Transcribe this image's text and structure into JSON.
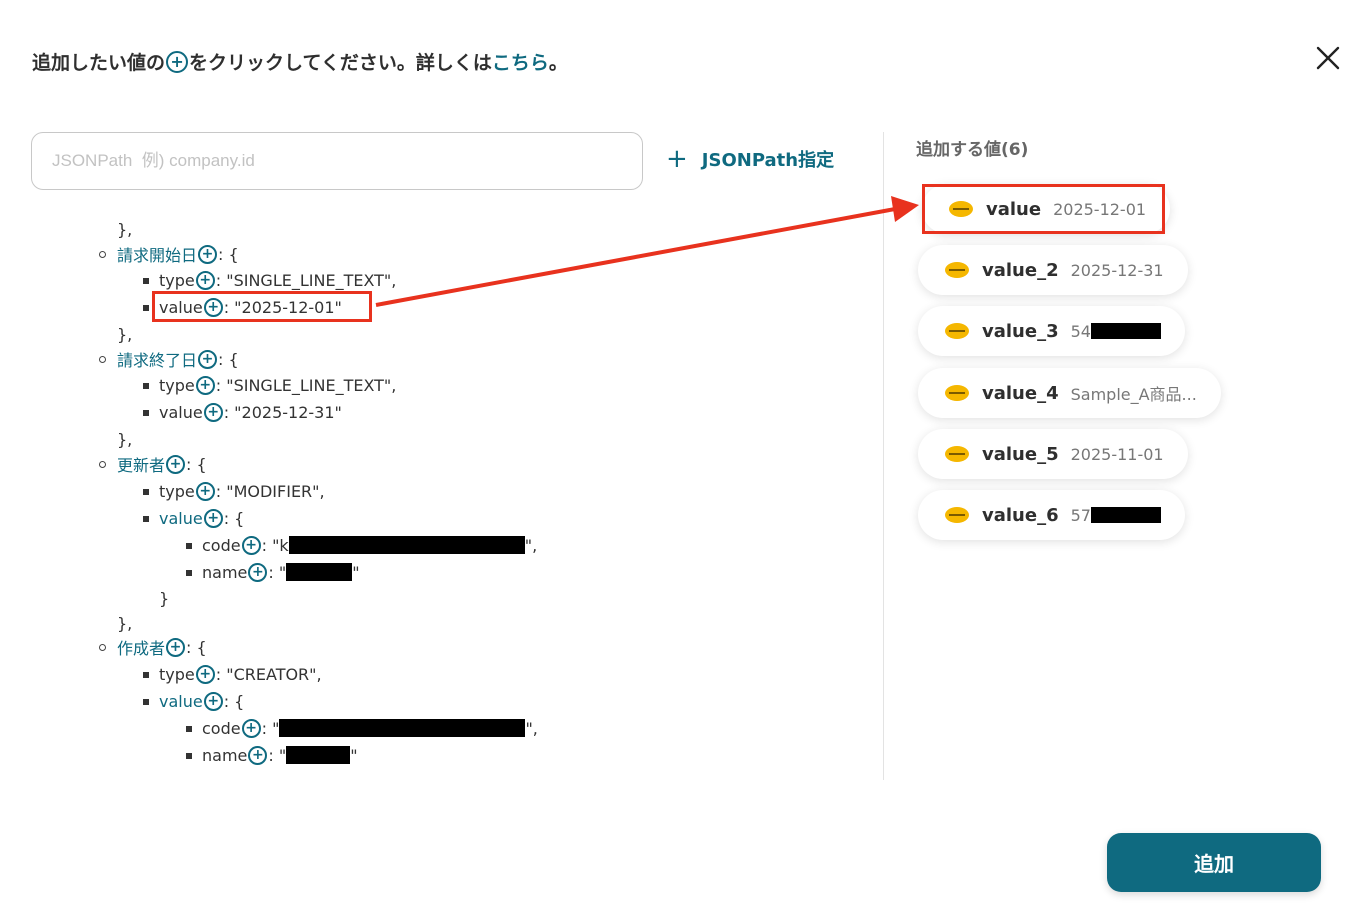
{
  "header": {
    "text_before": "追加したい値の",
    "text_after": "をクリックしてください。詳しくは",
    "link": "こちら",
    "period": "。"
  },
  "search": {
    "placeholder": "JSONPath  例) company.id"
  },
  "jsonpath_button": {
    "label": "JSONPath指定"
  },
  "tree": {
    "l1": "},",
    "l2_key": "請求開始日",
    "l2_rest": ": {",
    "l3_key": "type",
    "l3_rest": ": \"SINGLE_LINE_TEXT\",",
    "l4_key": "value",
    "l4_rest": ": \"2025-12-01\"",
    "l5": "},",
    "l6_key": "請求終了日",
    "l6_rest": ": {",
    "l7_key": "type",
    "l7_rest": ": \"SINGLE_LINE_TEXT\",",
    "l8_key": "value",
    "l8_rest": ": \"2025-12-31\"",
    "l9": "},",
    "l10_key": "更新者",
    "l10_rest": ": {",
    "l11_key": "type",
    "l11_rest": ": \"MODIFIER\",",
    "l12_key": "value",
    "l12_rest": ": {",
    "l13_key": "code",
    "l13_pre": ": \"k",
    "l13_post": "\",",
    "l14_key": "name",
    "l14_pre": ": \"",
    "l14_post": "\"",
    "l15": "}",
    "l16": "},",
    "l17_key": "作成者",
    "l17_rest": ": {",
    "l18_key": "type",
    "l18_rest": ": \"CREATOR\",",
    "l19_key": "value",
    "l19_rest": ": {",
    "l20_key": "code",
    "l20_pre": ": \"",
    "l20_post": "\",",
    "l21_key": "name",
    "l21_pre": ": \"",
    "l21_post": "\""
  },
  "added": {
    "title": "追加する値(6)",
    "items": [
      {
        "name": "value",
        "value": "2025-12-01"
      },
      {
        "name": "value_2",
        "value": "2025-12-31"
      },
      {
        "name": "value_3",
        "value": "54"
      },
      {
        "name": "value_4",
        "value": "Sample_A商品..."
      },
      {
        "name": "value_5",
        "value": "2025-11-01"
      },
      {
        "name": "value_6",
        "value": "57"
      }
    ]
  },
  "add_button": {
    "label": "追加"
  },
  "colors": {
    "accent": "#0f6a80",
    "highlight": "#e8321e",
    "kintone_logo": "#f5b700"
  },
  "icons": {
    "add": "plus-circle-icon",
    "close": "close-icon",
    "app_logo": "kintone-logo-icon"
  }
}
